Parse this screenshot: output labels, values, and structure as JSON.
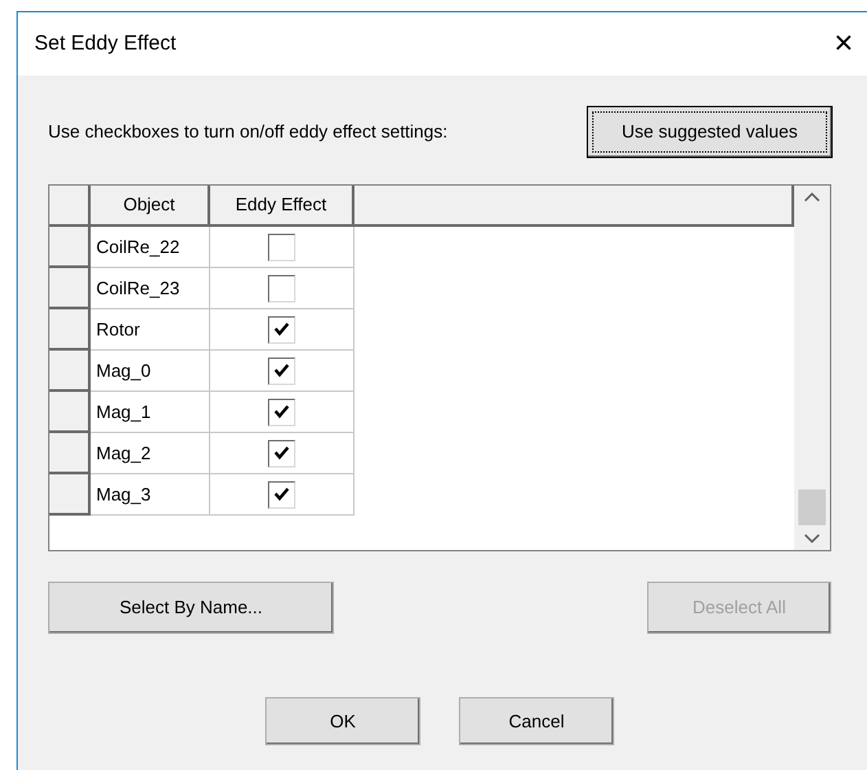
{
  "window": {
    "title": "Set Eddy Effect",
    "close": "×"
  },
  "instruction": "Use checkboxes to turn on/off eddy effect settings:",
  "suggest_button": {
    "label": "Use suggested values"
  },
  "table": {
    "columns": [
      "Object",
      "Eddy Effect"
    ],
    "rows": [
      {
        "object": "CoilRe_22",
        "checked": false
      },
      {
        "object": "CoilRe_23",
        "checked": false
      },
      {
        "object": "Rotor",
        "checked": true
      },
      {
        "object": "Mag_0",
        "checked": true
      },
      {
        "object": "Mag_1",
        "checked": true
      },
      {
        "object": "Mag_2",
        "checked": true
      },
      {
        "object": "Mag_3",
        "checked": true
      }
    ]
  },
  "select_button": {
    "label": "Select By Name...",
    "disabled": false
  },
  "deselect_button": {
    "label": "Deselect All",
    "disabled": true
  },
  "buttons": [
    "OK",
    "Cancel"
  ]
}
